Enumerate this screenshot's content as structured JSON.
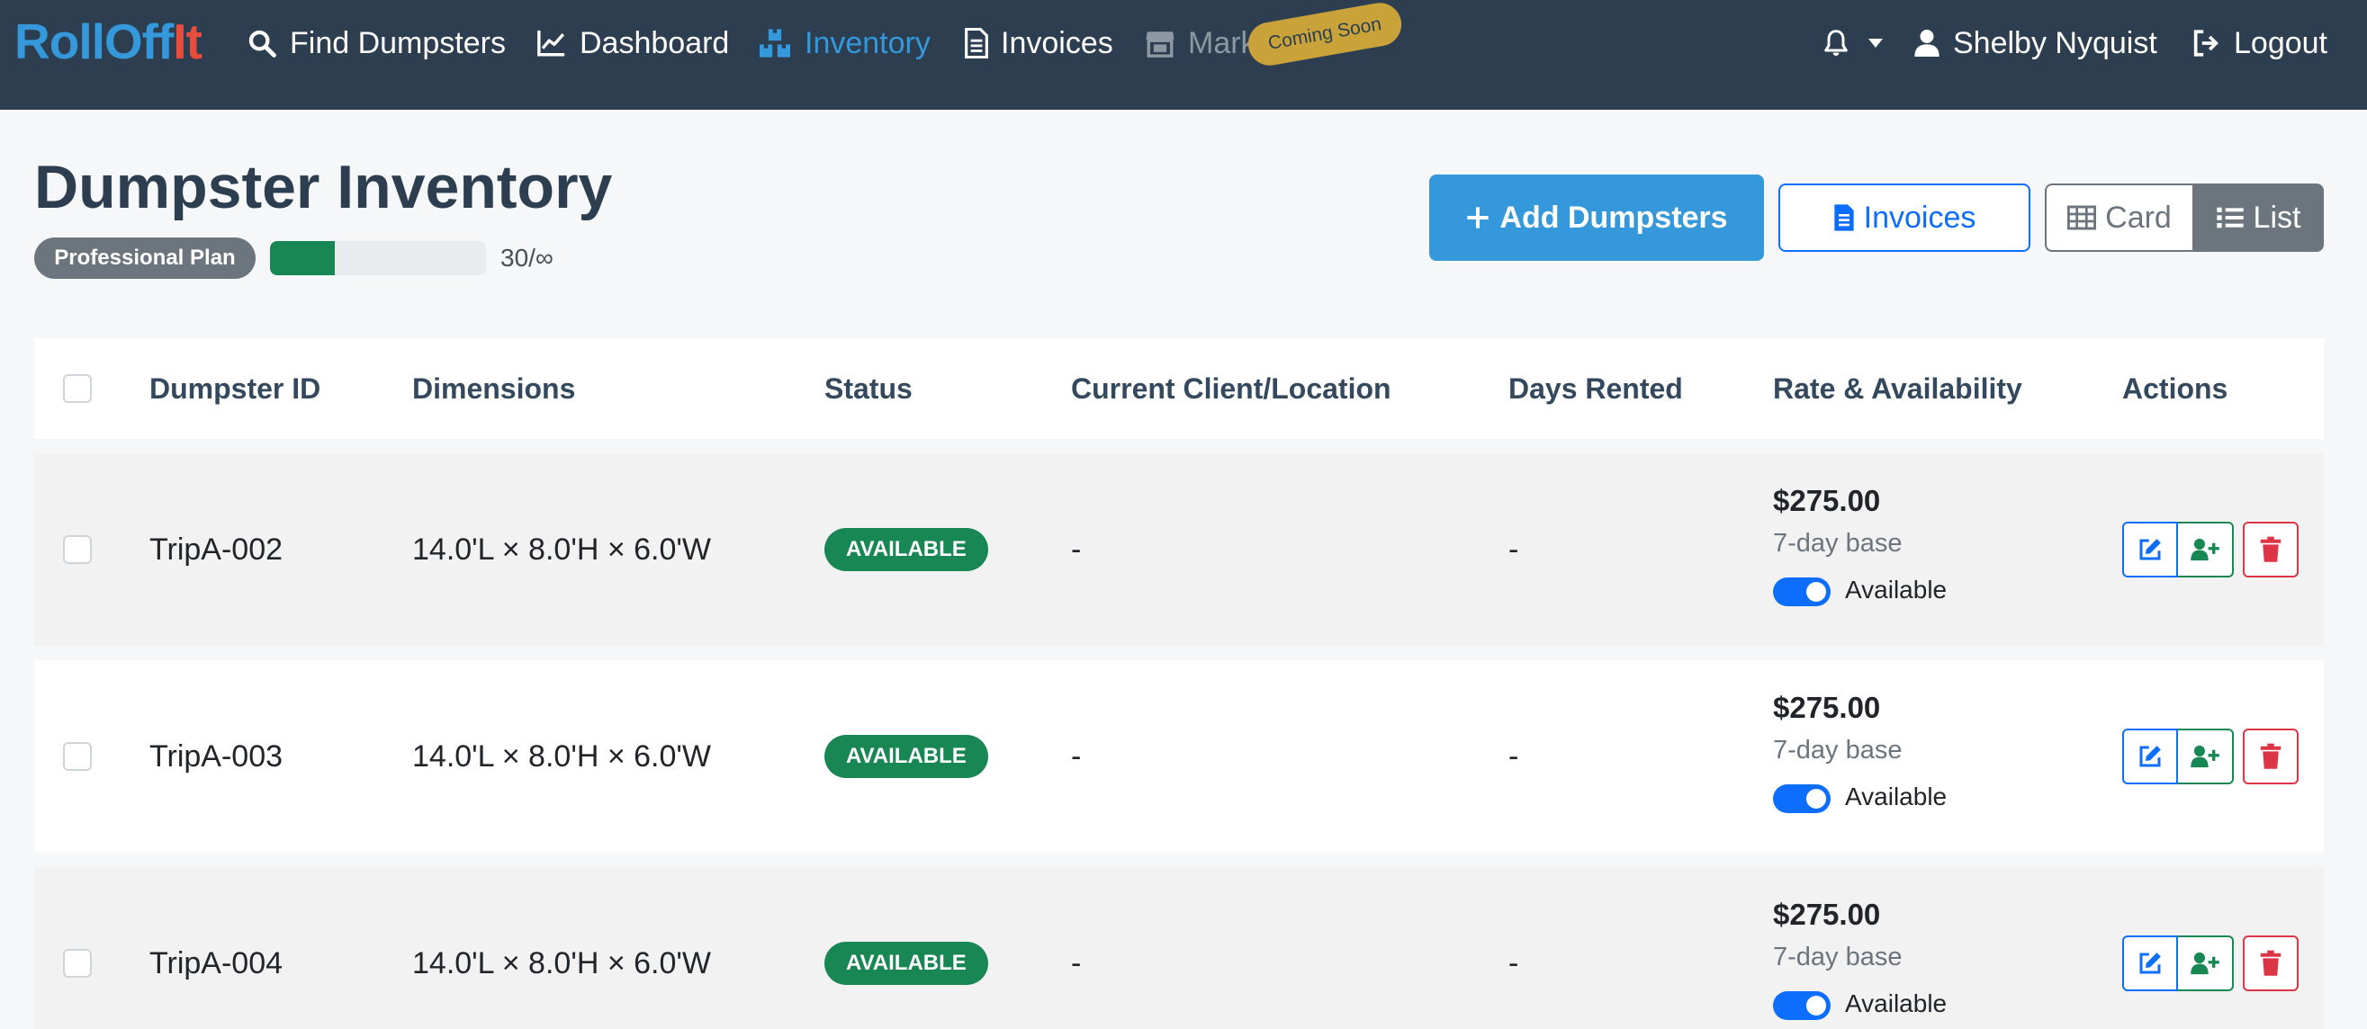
{
  "brand": {
    "part1": "RollOff",
    "part2": "It"
  },
  "nav": {
    "find": "Find Dumpsters",
    "dashboard": "Dashboard",
    "inventory": "Inventory",
    "invoices": "Invoices",
    "marketplace": "Mark",
    "coming_soon": "Coming Soon",
    "user": "Shelby Nyquist",
    "logout": "Logout"
  },
  "header": {
    "title": "Dumpster Inventory",
    "plan": "Professional Plan",
    "usage_fraction": 0.3,
    "usage_text": "30/∞"
  },
  "actions": {
    "add": "Add Dumpsters",
    "invoices": "Invoices",
    "card": "Card",
    "list": "List"
  },
  "table": {
    "headers": {
      "id": "Dumpster ID",
      "dimensions": "Dimensions",
      "status": "Status",
      "client": "Current Client/Location",
      "days": "Days Rented",
      "rate": "Rate & Availability",
      "actions": "Actions"
    },
    "rows": [
      {
        "id": "TripA-002",
        "dimensions": "14.0'L × 8.0'H × 6.0'W",
        "status": "AVAILABLE",
        "client": "-",
        "days": "-",
        "rate": "$275.00",
        "base": "7-day base",
        "availability": "Available"
      },
      {
        "id": "TripA-003",
        "dimensions": "14.0'L × 8.0'H × 6.0'W",
        "status": "AVAILABLE",
        "client": "-",
        "days": "-",
        "rate": "$275.00",
        "base": "7-day base",
        "availability": "Available"
      },
      {
        "id": "TripA-004",
        "dimensions": "14.0'L × 8.0'H × 6.0'W",
        "status": "AVAILABLE",
        "client": "-",
        "days": "-",
        "rate": "$275.00",
        "base": "7-day base",
        "availability": "Available"
      }
    ]
  },
  "colors": {
    "navbar": "#2c3e50",
    "brand_blue": "#3498db",
    "brand_red": "#e74c3c",
    "success": "#198754",
    "primary": "#0d6efd",
    "danger": "#dc3545"
  }
}
